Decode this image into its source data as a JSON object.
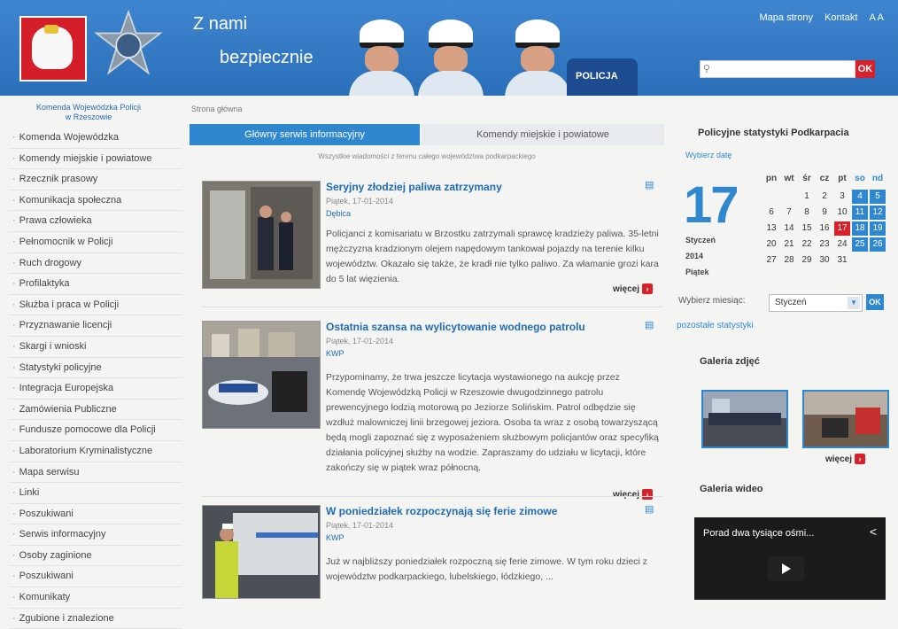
{
  "header": {
    "motto_line1": "Z nami",
    "motto_line2": "bezpiecznie",
    "badge_text": "POLICJA",
    "top_links": [
      "Mapa strony",
      "Kontakt",
      "A A"
    ],
    "search_button": "OK"
  },
  "sidebar": {
    "agency_line1": "Komenda Wojewódzka Policji",
    "agency_line2": "w Rzeszowie",
    "items": [
      "Komenda Wojewódzka",
      "Komendy miejskie i powiatowe",
      "Rzecznik prasowy",
      "Komunikacja społeczna",
      "Prawa człowieka",
      "Pełnomocnik w Policji",
      "Ruch drogowy",
      "Profilaktyka",
      "Służba i praca w Policji",
      "Przyznawanie licencji",
      "Skargi i wnioski",
      "Statystyki policyjne",
      "Integracja Europejska",
      "Zamówienia Publiczne",
      "Fundusze pomocowe dla Policji",
      "Laboratorium Kryminalistyczne",
      "Mapa serwisu",
      "Linki",
      "Poszukiwani",
      "Serwis informacyjny",
      "Osoby zaginione",
      "Poszukiwani",
      "Komunikaty",
      "Zgubione i znalezione"
    ]
  },
  "main": {
    "breadcrumb": "Strona główna",
    "tabs": [
      "Główny serwis informacyjny",
      "Komendy miejskie i powiatowe"
    ],
    "tab_note": "Wszystkie wiadomości z terenu całego województwa podkarpackiego",
    "more_label": "więcej",
    "articles": [
      {
        "title": "Seryjny złodziej paliwa zatrzymany",
        "date": "Piątek, 17-01-2014",
        "location": "Dębica",
        "text": "Policjanci z komisariatu w Brzostku zatrzymali sprawcę kradzieży paliwa. 35-letni mężczyzna kradzionym olejem napędowym tankował pojazdy na terenie kilku województw. Okazało się także, że kradł nie tylko paliwo. Za włamanie grozi kara do 5 lat więzienia."
      },
      {
        "title": "Ostatnia szansa na wylicytowanie wodnego patrolu",
        "date": "Piątek, 17-01-2014",
        "location": "KWP",
        "text": "Przypominamy, że trwa jeszcze licytacja wystawionego na aukcję przez Komendę Wojewódzką Policji w Rzeszowie dwugodzinnego patrolu prewencyjnego łodzią motorową po Jeziorze Solińskim. Patrol odbędzie się wzdłuż malowniczej linii brzegowej jeziora. Osoba ta wraz z osobą towarzyszącą będą mogli zapoznać się z wyposażeniem służbowym policjantów oraz specyfiką działania policyjnej służby na wodzie. Zapraszamy do udziału w licytacji, które zakończy się w piątek wraz północną."
      },
      {
        "title": "W poniedziałek rozpoczynają się ferie zimowe",
        "date": "Piątek, 17-01-2014",
        "location": "KWP",
        "text": "Już w najbliższy poniedziałek rozpoczną się ferie zimowe. W tym roku dzieci z województw podkarpackiego, lubelskiego, łódzkiego, ..."
      }
    ]
  },
  "right": {
    "stats_title": "Policyjne statystyki Podkarpacia",
    "stats_link": "Wybierz datę",
    "day_number": "17",
    "month_name": "Styczeń",
    "year": "2014",
    "weekday": "Piątek",
    "weekday_headers": [
      "pn",
      "wt",
      "śr",
      "cz",
      "pt",
      "so",
      "nd"
    ],
    "calendar_rows": [
      [
        "",
        "",
        "1",
        "2",
        "3",
        "4",
        "5"
      ],
      [
        "6",
        "7",
        "8",
        "9",
        "10",
        "11",
        "12"
      ],
      [
        "13",
        "14",
        "15",
        "16",
        "17",
        "18",
        "19"
      ],
      [
        "20",
        "21",
        "22",
        "23",
        "24",
        "25",
        "26"
      ],
      [
        "27",
        "28",
        "29",
        "30",
        "31",
        "",
        ""
      ]
    ],
    "month_select_label": "Wybierz miesiąc:",
    "month_select_value": "Styczeń",
    "ok_label": "OK",
    "other_stats_link": "pozostałe statystyki",
    "gallery_title": "Galeria zdjęć",
    "gallery_more": "więcej",
    "video_title": "Galeria wideo",
    "video_caption": "Porad dwa tysiące ośmi..."
  },
  "colors": {
    "header_blue": "#2b6fb9",
    "accent_blue": "#2f87cf",
    "accent_red": "#d7212b"
  }
}
